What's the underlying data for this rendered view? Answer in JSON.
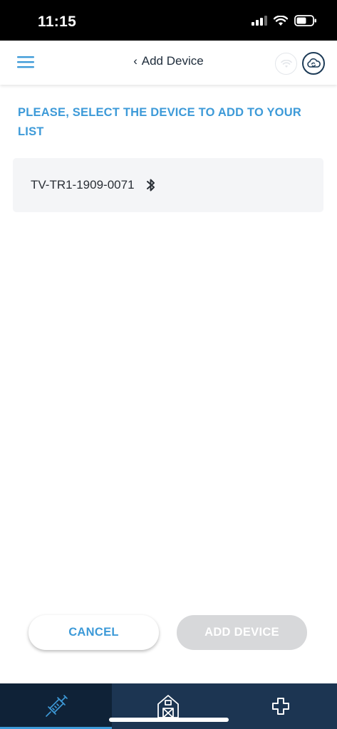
{
  "status_bar": {
    "time": "11:15",
    "icons": [
      "signal-icon",
      "wifi-icon",
      "battery-icon"
    ]
  },
  "header": {
    "back_label": "Add Device",
    "back_chevron": "‹",
    "icons": [
      "menu-icon",
      "wifi-status-icon",
      "cloud-sync-icon"
    ]
  },
  "main": {
    "instruction": "PLEASE, SELECT THE DEVICE TO ADD TO YOUR LIST",
    "devices": [
      {
        "name": "TV-TR1-1909-0071",
        "connection_icon": "bluetooth-icon"
      }
    ]
  },
  "actions": {
    "cancel_label": "CANCEL",
    "add_device_label": "ADD DEVICE"
  },
  "tab_bar": {
    "tabs": [
      {
        "icon": "syringe-icon",
        "active": true
      },
      {
        "icon": "barn-icon",
        "active": false
      },
      {
        "icon": "medical-cross-icon",
        "active": false
      }
    ]
  },
  "colors": {
    "accent_blue": "#3d9ad8",
    "navy": "#1c3552",
    "navy_dark": "#0f2237",
    "disabled_gray": "#d7d8da",
    "card_bg": "#f4f5f7"
  }
}
